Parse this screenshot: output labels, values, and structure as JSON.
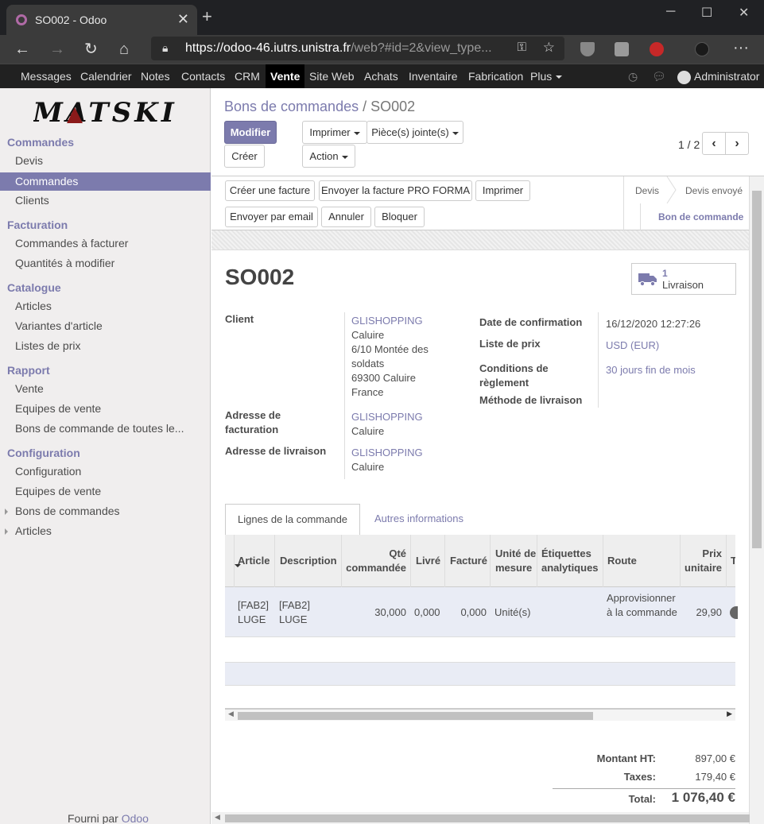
{
  "browser": {
    "tab_title": "SO002 - Odoo",
    "url_host": "https://odoo-46.iutrs.unistra.fr",
    "url_rest": "/web?#id=2&view_type..."
  },
  "topnav": {
    "items": [
      "Messages",
      "Calendrier",
      "Notes",
      "Contacts",
      "CRM",
      "Vente",
      "Site Web",
      "Achats",
      "Inventaire",
      "Fabrication",
      "Plus"
    ],
    "active": "Vente",
    "user": "Administrator"
  },
  "sidebar": {
    "logo": "MATSKI",
    "sections": [
      {
        "title": "Commandes",
        "items": [
          "Devis",
          "Commandes",
          "Clients"
        ]
      },
      {
        "title": "Facturation",
        "items": [
          "Commandes à facturer",
          "Quantités à modifier"
        ]
      },
      {
        "title": "Catalogue",
        "items": [
          "Articles",
          "Variantes d'article",
          "Listes de prix"
        ]
      },
      {
        "title": "Rapport",
        "items": [
          "Vente",
          "Equipes de vente",
          "Bons de commande de toutes le..."
        ]
      },
      {
        "title": "Configuration",
        "items": [
          "Configuration",
          "Equipes de vente",
          "Bons de commandes",
          "Articles"
        ]
      }
    ],
    "active_item": "Commandes",
    "powered_by": "Fourni par",
    "powered_brand": "Odoo"
  },
  "control_panel": {
    "breadcrumb_parent": "Bons de commandes",
    "breadcrumb_sep": "/",
    "breadcrumb_current": "SO002",
    "edit_button": "Modifier",
    "create_button": "Créer",
    "print_button": "Imprimer",
    "attachments_button": "Pièce(s) jointe(s)",
    "action_button": "Action",
    "pager": "1 / 2"
  },
  "statusbar": {
    "buttons": [
      "Créer une facture",
      "Envoyer la facture PRO FORMA",
      "Imprimer",
      "Envoyer par email",
      "Annuler",
      "Bloquer"
    ],
    "stages": [
      "Devis",
      "Devis envoyé",
      "Bon de commande"
    ],
    "current_stage": "Bon de commande"
  },
  "form": {
    "title": "SO002",
    "delivery_count": "1",
    "delivery_label": "Livraison",
    "client_label": "Client",
    "client_name": "GLISHOPPING",
    "client_address": [
      "Caluire",
      "6/10 Montée des",
      "soldats",
      "69300 Caluire",
      "France"
    ],
    "invoice_addr_label": "Adresse de facturation",
    "invoice_addr_name": "GLISHOPPING",
    "invoice_addr_city": "Caluire",
    "delivery_addr_label": "Adresse de livraison",
    "delivery_addr_name": "GLISHOPPING",
    "delivery_addr_city": "Caluire",
    "confirm_date_label": "Date de confirmation",
    "confirm_date": "16/12/2020 12:27:26",
    "pricelist_label": "Liste de prix",
    "pricelist": "USD (EUR)",
    "payment_terms_label": "Conditions de règlement",
    "payment_terms": "30 jours fin de mois",
    "delivery_method_label": "Méthode de livraison"
  },
  "tabs": [
    "Lignes de la commande",
    "Autres informations"
  ],
  "order_lines": {
    "columns": [
      "Article",
      "Description",
      "Qté commandée",
      "Livré",
      "Facturé",
      "Unité de mesure",
      "Étiquettes analytiques",
      "Route",
      "Prix unitaire",
      "T"
    ],
    "rows": [
      {
        "article": "[FAB2] LUGE",
        "description": "[FAB2] LUGE",
        "qty": "30,000",
        "delivered": "0,000",
        "invoiced": "0,000",
        "uom": "Unité(s)",
        "tags": "",
        "route": "Approvisionner à la commande",
        "unit_price": "29,90"
      }
    ]
  },
  "totals": {
    "untaxed_label": "Montant HT:",
    "untaxed": "897,00 €",
    "taxes_label": "Taxes:",
    "taxes": "179,40 €",
    "total_label": "Total:",
    "total": "1 076,40 €"
  },
  "colors": {
    "accent": "#7c7bad",
    "topbar": "#212121",
    "row_highlight": "#e9ecf5"
  }
}
